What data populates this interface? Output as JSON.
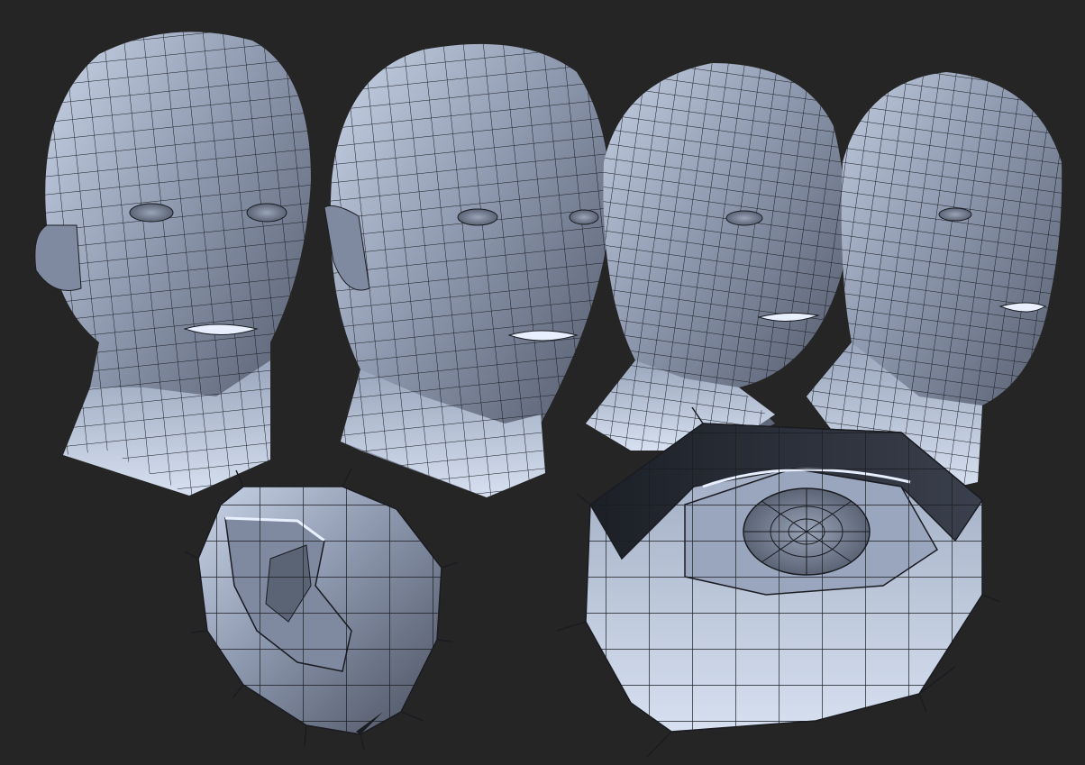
{
  "scene": {
    "background": "#252525",
    "mesh_fill_light": "#b9c6dc",
    "mesh_fill_mid": "#7f8aa0",
    "mesh_fill_dark": "#3c4250",
    "wire_color": "#1a1c22",
    "highlight": "#e8f0ff",
    "objects": [
      {
        "name": "head-mesh-front"
      },
      {
        "name": "head-mesh-three-quarter"
      },
      {
        "name": "head-mesh-side-quarter"
      },
      {
        "name": "head-mesh-profile"
      },
      {
        "name": "ear-mesh-closeup"
      },
      {
        "name": "eye-socket-mesh-closeup"
      }
    ]
  }
}
